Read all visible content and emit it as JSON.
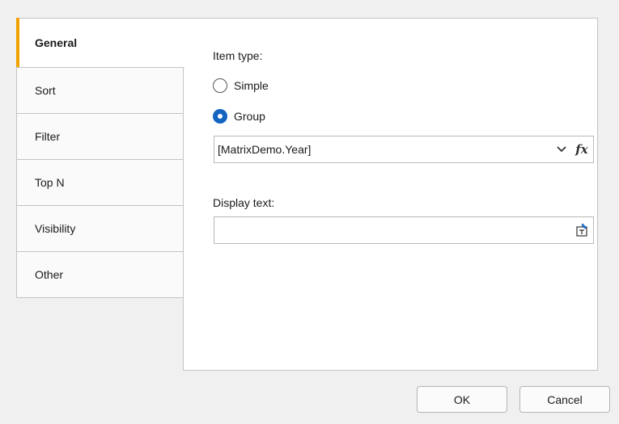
{
  "tabs": [
    {
      "label": "General",
      "active": true
    },
    {
      "label": "Sort",
      "active": false
    },
    {
      "label": "Filter",
      "active": false
    },
    {
      "label": "Top N",
      "active": false
    },
    {
      "label": "Visibility",
      "active": false
    },
    {
      "label": "Other",
      "active": false
    }
  ],
  "general": {
    "item_type_label": "Item type:",
    "options": [
      {
        "label": "Simple",
        "checked": false
      },
      {
        "label": "Group",
        "checked": true
      }
    ],
    "group_expression": "[MatrixDemo.Year]",
    "fx_label": "fx",
    "display_text_label": "Display text:",
    "display_text_value": ""
  },
  "buttons": {
    "ok": "OK",
    "cancel": "Cancel"
  },
  "colors": {
    "accent": "#f0a300",
    "radio_checked": "#1565c0"
  }
}
